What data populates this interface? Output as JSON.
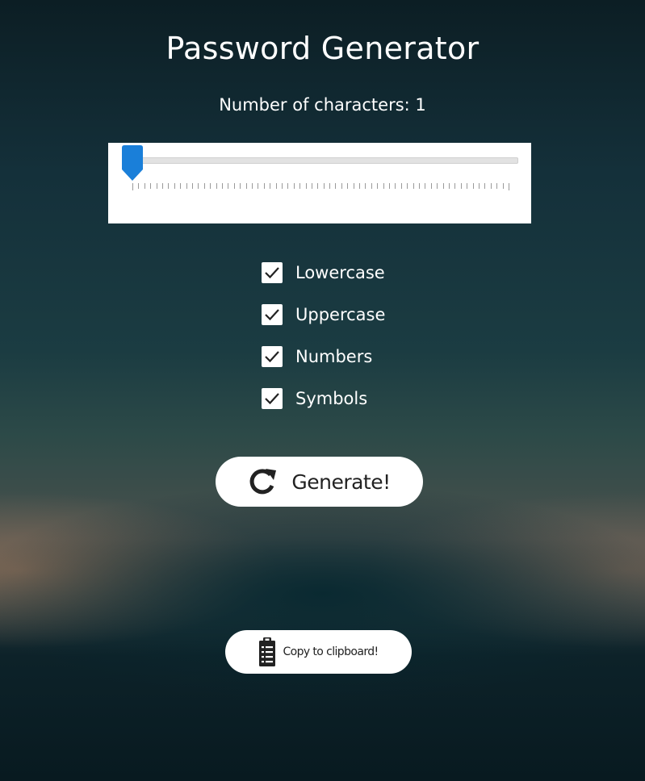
{
  "app": {
    "title": "Password Generator"
  },
  "length": {
    "label": "Number of characters: ",
    "value": "1",
    "min": 1,
    "max": 64,
    "accent_color": "#1a7fd9"
  },
  "options": [
    {
      "id": "lowercase",
      "label": "Lowercase",
      "checked": true
    },
    {
      "id": "uppercase",
      "label": "Uppercase",
      "checked": true
    },
    {
      "id": "numbers",
      "label": "Numbers",
      "checked": true
    },
    {
      "id": "symbols",
      "label": "Symbols",
      "checked": true
    }
  ],
  "actions": {
    "generate_label": "Generate!",
    "generate_icon": "refresh-icon",
    "copy_label": "Copy to clipboard!",
    "copy_icon": "clipboard-icon"
  }
}
